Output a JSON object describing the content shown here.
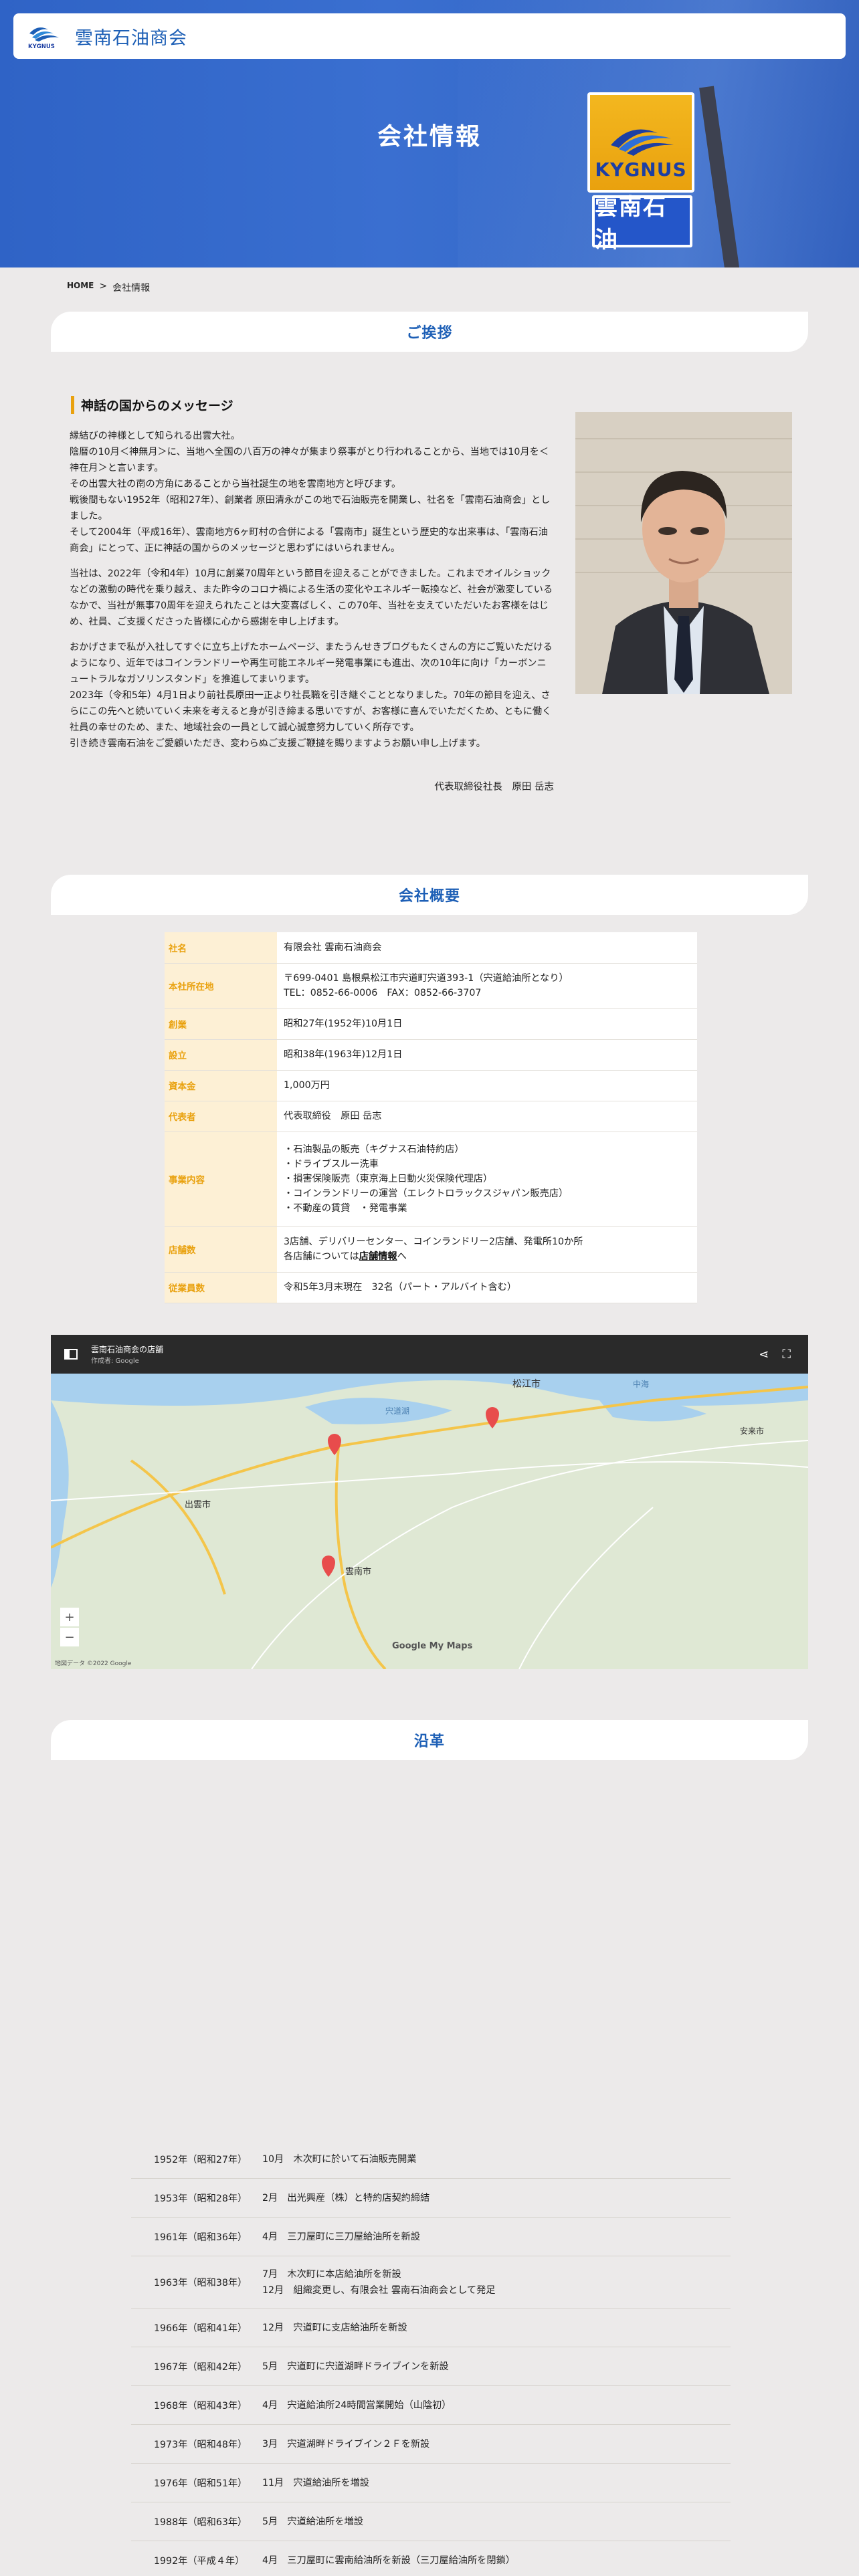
{
  "header": {
    "brand_mark": "KYGNUS",
    "brand_name": "雲南石油商会"
  },
  "hero": {
    "title": "会社情報",
    "sign_top": "KYGNUS",
    "sign_bottom": "雲南石油"
  },
  "breadcrumb": {
    "home": "HOME",
    "sep": ">",
    "current": "会社情報"
  },
  "greeting": {
    "heading": "ご挨拶",
    "title": "神話の国からのメッセージ",
    "paragraphs": [
      "縁結びの神様として知られる出雲大社。\n陰暦の10月＜神無月＞に、当地へ全国の八百万の神々が集まり祭事がとり行われることから、当地では10月を＜神在月＞と言います。\nその出雲大社の南の方角にあることから当社誕生の地を雲南地方と呼びます。\n戦後間もない1952年（昭和27年）、創業者 原田清永がこの地で石油販売を開業し、社名を「雲南石油商会」としました。\nそして2004年（平成16年）、雲南地方6ヶ町村の合併による「雲南市」誕生という歴史的な出来事は、「雲南石油商会」にとって、正に神話の国からのメッセージと思わずにはいられません。",
      "当社は、2022年（令和4年）10月に創業70周年という節目を迎えることができました。これまでオイルショックなどの激動の時代を乗り越え、また昨今のコロナ禍による生活の変化やエネルギー転換など、社会が激変しているなかで、当社が無事70周年を迎えられたことは大変喜ばしく、この70年、当社を支えていただいたお客様をはじめ、社員、ご支援くださった皆様に心から感謝を申し上げます。",
      "おかげさまで私が入社してすぐに立ち上げたホームページ、またうんせきブログもたくさんの方にご覧いただけるようになり、近年ではコインランドリーや再生可能エネルギー発電事業にも進出、次の10年に向け「カーボンニュートラルなガソリンスタンド」を推進してまいります。\n2023年（令和5年）4月1日より前社長原田一正より社長職を引き継ぐこととなりました。70年の節目を迎え、さらにこの先へと続いていく未来を考えると身が引き締まる思いですが、お客様に喜んでいただくため、ともに働く社員の幸せのため、また、地域社会の一員として誠心誠意努力していく所存です。\n引き続き雲南石油をご愛顧いただき、変わらぬご支援ご鞭撻を賜りますようお願い申し上げます。"
    ],
    "signature": "代表取締役社長　原田 岳志"
  },
  "overview": {
    "heading": "会社概要",
    "rows": [
      {
        "label": "社名",
        "value": "有限会社 雲南石油商会"
      },
      {
        "label": "本社所在地",
        "value": "〒699-0401 島根県松江市宍道町宍道393-1（宍道給油所となり）\nTEL：0852-66-0006　FAX：0852-66-3707"
      },
      {
        "label": "創業",
        "value": "昭和27年(1952年)10月1日"
      },
      {
        "label": "設立",
        "value": "昭和38年(1963年)12月1日"
      },
      {
        "label": "資本金",
        "value": "1,000万円"
      },
      {
        "label": "代表者",
        "value": "代表取締役　原田 岳志"
      },
      {
        "label": "事業内容",
        "value": "・石油製品の販売（キグナス石油特約店）\n・ドライブスルー洗車\n・損害保険販売（東京海上日動火災保険代理店）\n・コインランドリーの運営（エレクトロラックスジャパン販売店）\n・不動産の賃貸　・発電事業"
      },
      {
        "label": "店舗数",
        "value": "3店舗、デリバリーセンター、コインランドリー2店舗、発電所10か所",
        "value2": "各店舗については",
        "link": "店舗情報",
        "value3": "へ"
      },
      {
        "label": "従業員数",
        "value": "令和5年3月末現在　32名（パート・アルバイト含む）"
      }
    ]
  },
  "map": {
    "title": "雲南石油商会の店舗",
    "subtitle": "作成者: Google",
    "labels": [
      "松江市",
      "宍道湖",
      "出雲市",
      "雲南市",
      "中海",
      "安来市"
    ],
    "google": "Google My Maps",
    "copyright": "地図データ ©2022 Google",
    "zoom_in": "+",
    "zoom_out": "−"
  },
  "history": {
    "heading": "沿革",
    "rows": [
      {
        "year": "1952年（昭和27年）",
        "event": "10月　木次町に於いて石油販売開業"
      },
      {
        "year": "1953年（昭和28年）",
        "event": "2月　出光興産（株）と特約店契約締結"
      },
      {
        "year": "1961年（昭和36年）",
        "event": "4月　三刀屋町に三刀屋給油所を新設"
      },
      {
        "year": "1963年（昭和38年）",
        "event": "7月　木次町に本店給油所を新設\n12月　組織変更し、有限会社 雲南石油商会として発足"
      },
      {
        "year": "1966年（昭和41年）",
        "event": "12月　宍道町に支店給油所を新設"
      },
      {
        "year": "1967年（昭和42年）",
        "event": "5月　宍道町に宍道湖畔ドライブインを新設"
      },
      {
        "year": "1968年（昭和43年）",
        "event": "4月　宍道給油所24時間営業開始（山陰初）"
      },
      {
        "year": "1973年（昭和48年）",
        "event": "3月　宍道湖畔ドライブイン２Ｆを新設"
      },
      {
        "year": "1976年（昭和51年）",
        "event": "11月　宍道給油所を増設"
      },
      {
        "year": "1988年（昭和63年）",
        "event": "5月　宍道給油所を増設"
      },
      {
        "year": "1992年（平成４年）",
        "event": "4月　三刀屋町に雲南給油所を新設（三刀屋給油所を閉鎖）"
      }
    ]
  }
}
